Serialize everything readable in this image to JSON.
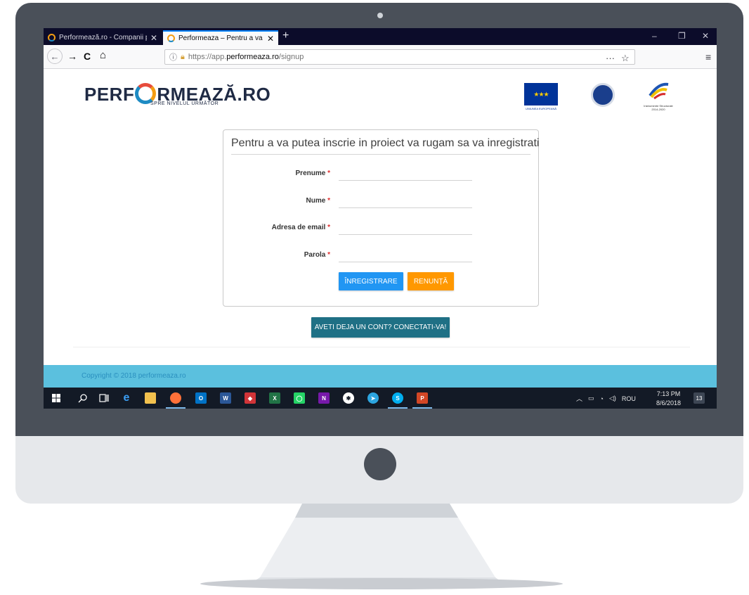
{
  "browser": {
    "tabs": [
      {
        "title": "Performează.ro - Companii per",
        "close": "✕"
      },
      {
        "title": "Performeaza – Pentru a va pute",
        "close": "✕"
      }
    ],
    "new_tab": "+",
    "window_controls": {
      "minimize": "–",
      "restore": "❐",
      "close": "✕"
    },
    "nav": {
      "back": "←",
      "forward": "→",
      "reload": "C",
      "home": "⌂"
    },
    "url": {
      "prefix": "https://app.",
      "domain": "performeaza.ro",
      "path": "/signup"
    },
    "url_actions": {
      "more": "···",
      "bookmark": "☆"
    },
    "menu": "≡"
  },
  "header": {
    "brand_left": "PERF",
    "brand_right": "RMEAZĂ.RO",
    "tagline": "SPRE NIVELUL URMĂTOR",
    "eu_caption": "UNIUNEA EUROPEANĂ",
    "ip_caption": "Instrumente Structurale 2014-2020"
  },
  "form": {
    "title": "Pentru a va putea inscrie in proiect va rugam sa va inregistrati",
    "fields": [
      {
        "label": "Prenume",
        "required": "*",
        "value": ""
      },
      {
        "label": "Nume",
        "required": "*",
        "value": ""
      },
      {
        "label": "Adresa de email",
        "required": "*",
        "value": ""
      },
      {
        "label": "Parola",
        "required": "*",
        "value": ""
      }
    ],
    "register_label": "ÎNREGISTRARE",
    "cancel_label": "RENUNȚĂ"
  },
  "login_label": "AVETI DEJA UN CONT? CONECTATI-VA!",
  "footer": {
    "copyright": "Copyright © 2018 performeaza.ro"
  },
  "taskbar": {
    "tray_language": "ROU",
    "time": "7:13 PM",
    "date": "8/6/2018",
    "notifications": "13",
    "apps": [
      "windows-start",
      "search",
      "task-view",
      "edge",
      "file-explorer",
      "firefox",
      "outlook",
      "word",
      "security",
      "excel",
      "whatsapp",
      "onenote",
      "app-unknown",
      "telegram",
      "skype",
      "powerpoint"
    ]
  },
  "colors": {
    "accent_blue": "#2196f3",
    "accent_orange": "#ff9800",
    "login_teal": "#1f7085",
    "footer_cyan": "#5bc0de",
    "required_red": "#e02d2d"
  }
}
